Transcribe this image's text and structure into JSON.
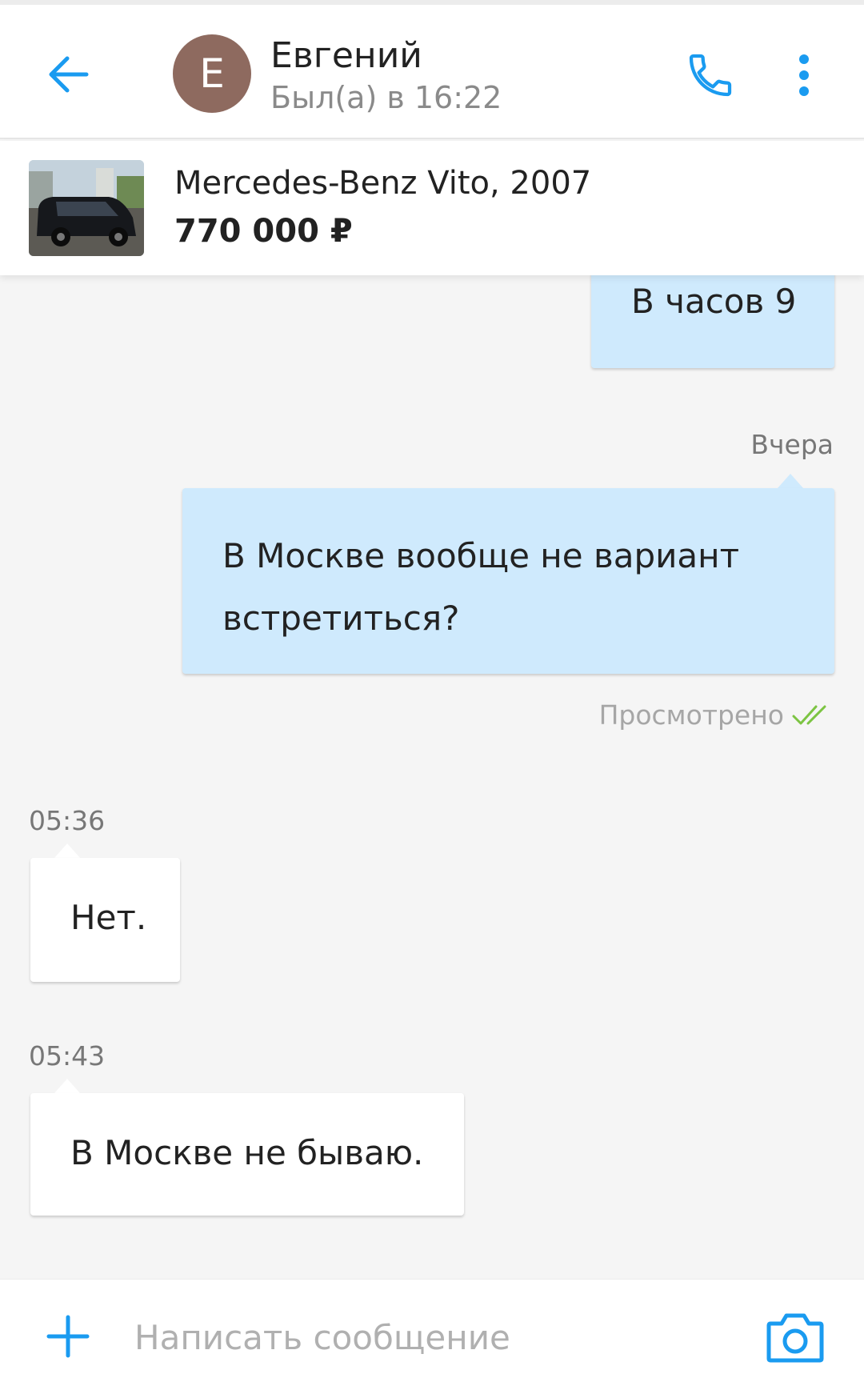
{
  "header": {
    "avatar_letter": "Е",
    "contact_name": "Евгений",
    "status": "Был(а) в 16:22"
  },
  "ad": {
    "title": "Mercedes-Benz Vito, 2007",
    "price": "770 000 ₽"
  },
  "messages": [
    {
      "direction": "out",
      "text": "В часов 9"
    },
    {
      "direction": "out",
      "date": "Вчера",
      "text": "В Москве вообще не вариант встретиться?",
      "status": "Просмотрено"
    },
    {
      "direction": "in",
      "time": "05:36",
      "text": "Нет."
    },
    {
      "direction": "in",
      "time": "05:43",
      "text": "В Москве не бываю."
    }
  ],
  "composer": {
    "placeholder": "Написать сообщение"
  },
  "colors": {
    "accent": "#1a9bf0",
    "outgoing_bubble": "#cfeafd",
    "avatar": "#8e6a5f",
    "seen_check": "#7cc442"
  }
}
